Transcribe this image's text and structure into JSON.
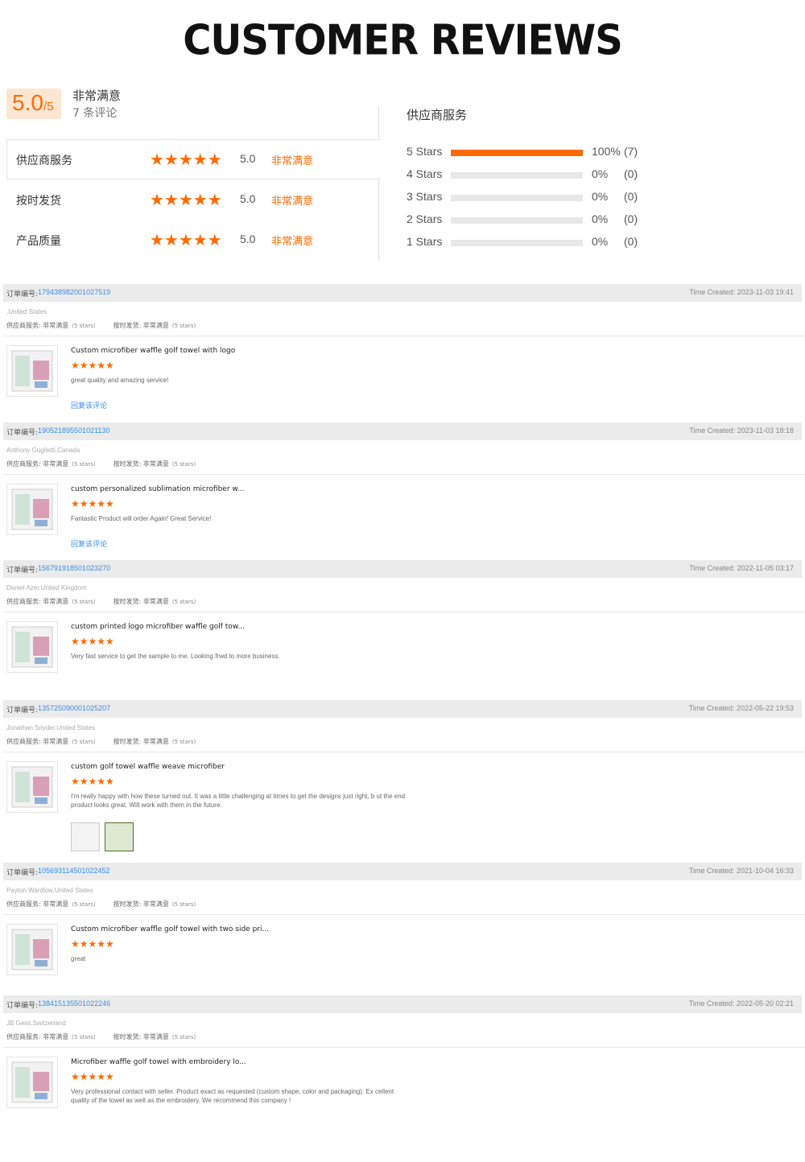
{
  "title": "CUSTOMER REVIEWS",
  "summary": {
    "score": "5.0",
    "score_max": "/5",
    "overall_label": "非常满意",
    "review_count": "7 条评论",
    "ratings": [
      {
        "label": "供应商服务",
        "stars": "★★★★★",
        "value": "5.0",
        "text": "非常满意"
      },
      {
        "label": "按时发货",
        "stars": "★★★★★",
        "value": "5.0",
        "text": "非常满意"
      },
      {
        "label": "产品质量",
        "stars": "★★★★★",
        "value": "5.0",
        "text": "非常满意"
      }
    ],
    "distribution_title": "供应商服务",
    "distribution": [
      {
        "label": "5  Stars",
        "percent": 100,
        "pct_text": "100%",
        "count": "(7)"
      },
      {
        "label": "4  Stars",
        "percent": 0,
        "pct_text": "0%",
        "count": "(0)"
      },
      {
        "label": "3  Stars",
        "percent": 0,
        "pct_text": "0%",
        "count": "(0)"
      },
      {
        "label": "2  Stars",
        "percent": 0,
        "pct_text": "0%",
        "count": "(0)"
      },
      {
        "label": "1  Stars",
        "percent": 0,
        "pct_text": "0%",
        "count": "(0)"
      }
    ]
  },
  "labels": {
    "order_no": "订单编号:",
    "supplier_service": "供应商服务:",
    "on_time": "按时发货:",
    "satisfied": "非常满意",
    "five_stars": "(5 stars)",
    "reply": "回复该评论"
  },
  "reviews": [
    {
      "order": "179438982001027519",
      "time": "Time Created: 2023-11-03 19:41",
      "buyer": ",United States",
      "product": "Custom microfiber waffle golf towel with logo",
      "stars": "★★★★★",
      "comment": "great quality and amazing service!",
      "reply": "回复该评论"
    },
    {
      "order": "190521895501021130",
      "time": "Time Created: 2023-11-03 18:18",
      "buyer": "Anthony Guglietti,Canada",
      "product": "custom personalized sublimation microfiber w...",
      "stars": "★★★★★",
      "comment": "Fantastic Product will order Again! Great Service!",
      "reply": "回复该评论"
    },
    {
      "order": "156791918501023270",
      "time": "Time Created: 2022-11-05 03:17",
      "buyer": "Daniel Azer,United Kingdom",
      "product": "custom printed logo microfiber waffle golf tow...",
      "stars": "★★★★★",
      "comment": "Very fast service to get the sample to me. Looking frwd to more business.",
      "reply": ""
    },
    {
      "order": "135725090001025207",
      "time": "Time Created: 2022-05-22 19:53",
      "buyer": "Jonathan Snyder,United States",
      "product": "custom golf towel waffle weave microfiber",
      "stars": "★★★★★",
      "comment": "I'm really happy with how these turned out. It was a little challenging at times to get the designs just right, b ut the end product looks great. Will work with them in the future.",
      "reply": ""
    },
    {
      "order": "105693114501022452",
      "time": "Time Created: 2021-10-04 16:33",
      "buyer": "Payton Wardlow,United States",
      "product": "Custom microfiber waffle golf towel with two side pri...",
      "stars": "★★★★★",
      "comment": "great",
      "reply": ""
    },
    {
      "order": "138415135501022246",
      "time": "Time Created: 2022-05-20 02:21",
      "buyer": "JB Geist,Switzerland",
      "product": "Microfiber waffle golf towel with embroidery lo...",
      "stars": "★★★★★",
      "comment": "Very professional contact with seller. Product exact as requested (custom shape, color and packaging). Ex cellent quality of the towel as well as the embroidery. We recommend this company !",
      "reply": ""
    }
  ],
  "colors": {
    "accent": "#ff6a00",
    "link": "#3a8ee6",
    "header_bg": "#ebebeb",
    "score_bg": "#fde6d2"
  }
}
